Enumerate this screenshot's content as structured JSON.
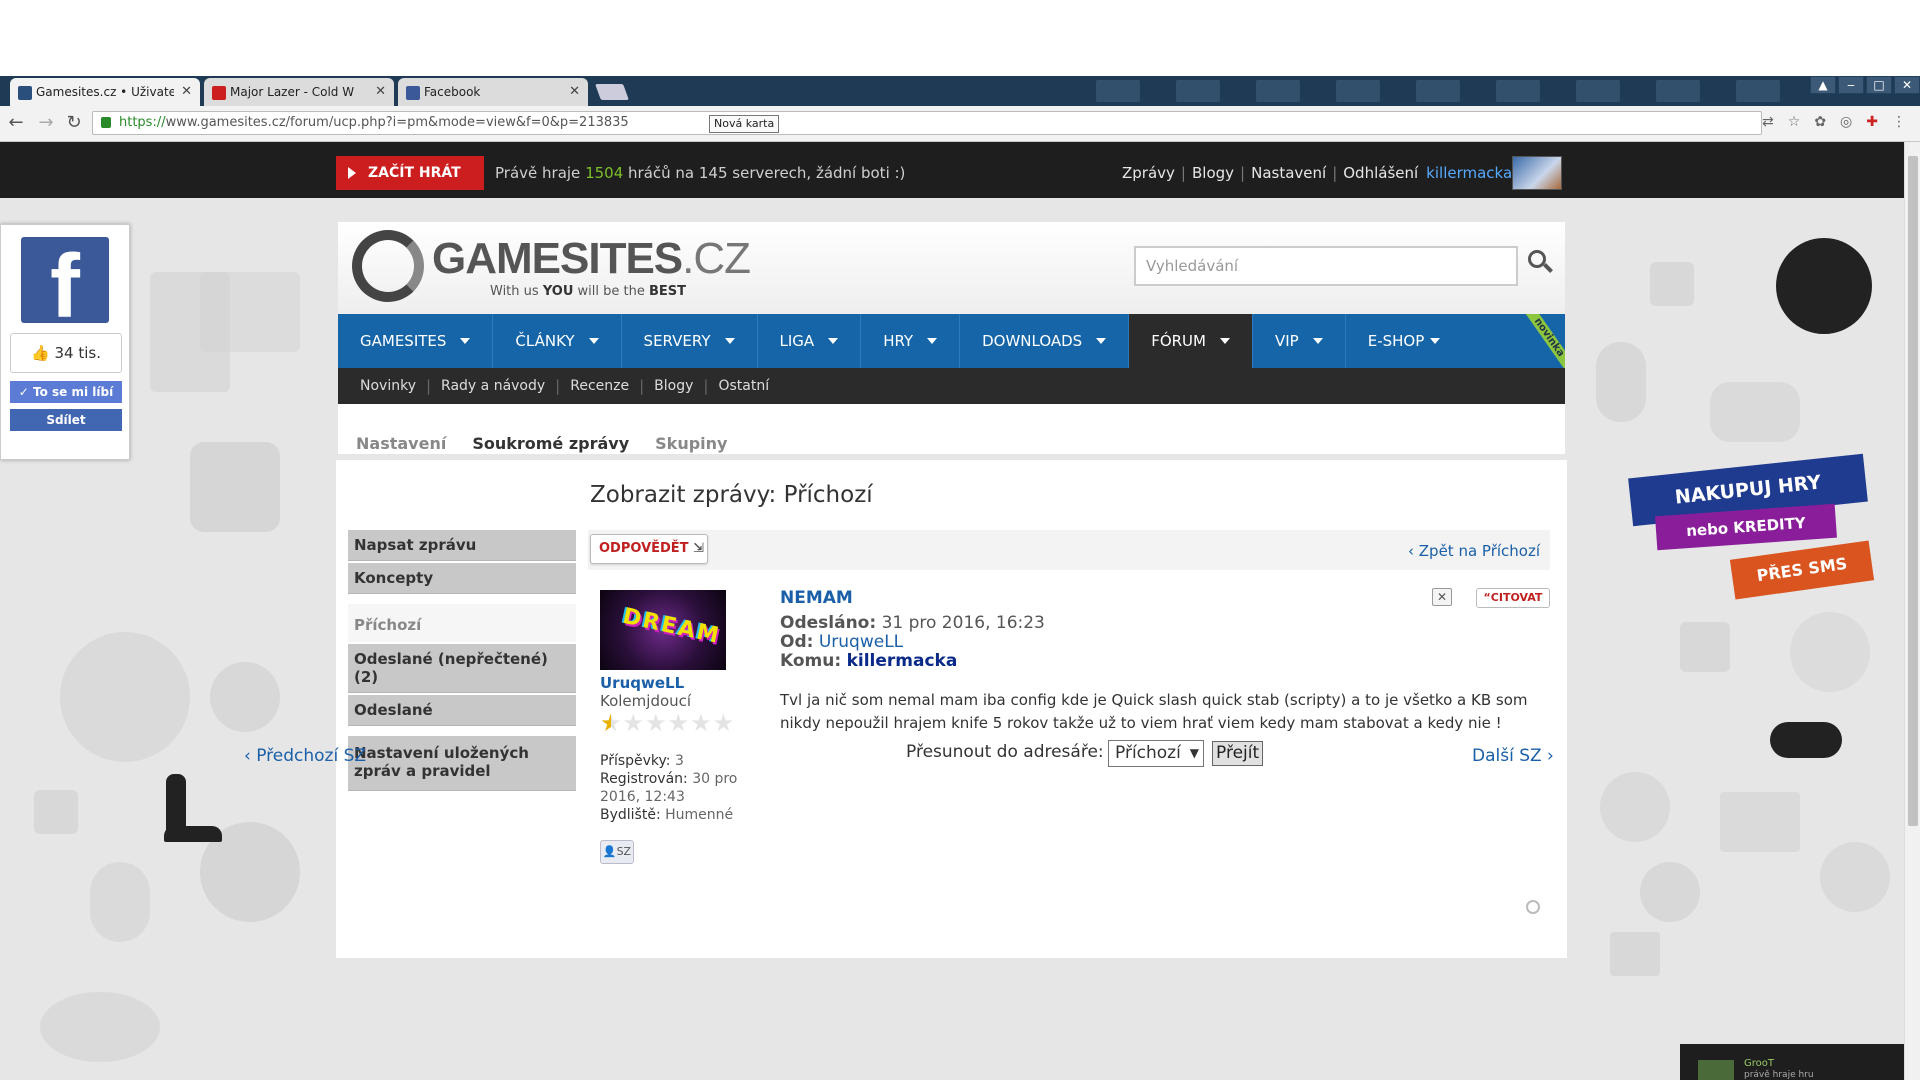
{
  "browser": {
    "tabs": [
      {
        "label": "Gamesites.cz • Uživatelsk",
        "favicon_color": "#2b4f7d"
      },
      {
        "label": "Major Lazer - Cold W",
        "favicon_color": "#cc1e1e"
      },
      {
        "label": "Facebook",
        "favicon_color": "#3b5998"
      }
    ],
    "url_scheme": "https://",
    "url_rest": "www.gamesites.cz/forum/ucp.php?i=pm&mode=view&f=0&p=213835",
    "url_tooltip": "Nová karta"
  },
  "topbar": {
    "play_label": "ZAČÍT HRÁT",
    "players_prefix": "Právě hraje",
    "players_count": "1504",
    "players_suffix": "hráčů na 145 serverech, žádní boti :)",
    "links": [
      "Zprávy",
      "Blogy",
      "Nastavení",
      "Odhlášení"
    ],
    "username": "killermacka"
  },
  "facebook": {
    "likes": "34 tis.",
    "like_label": "To se mi líbí",
    "share_label": "Sdílet"
  },
  "site": {
    "logo_bold": "GAMESITES",
    "logo_thin": ".CZ",
    "slogan_pre": "With us",
    "slogan_you": "YOU",
    "slogan_mid": "will be the",
    "slogan_best": "BEST",
    "search_placeholder": "Vyhledávání"
  },
  "main_nav": [
    "GAMESITES",
    "ČLÁNKY",
    "SERVERY",
    "LIGA",
    "HRY",
    "DOWNLOADS",
    "FÓRUM",
    "VIP",
    "E-SHOP"
  ],
  "ribbon": "novinka",
  "sub_nav": [
    "Novinky",
    "Rady a návody",
    "Recenze",
    "Blogy",
    "Ostatní"
  ],
  "ucp_tabs": [
    "Nastavení",
    "Soukromé zprávy",
    "Skupiny"
  ],
  "page_title": "Zobrazit zprávy: Příchozí",
  "side_menu": {
    "compose": "Napsat zprávu",
    "drafts": "Koncepty",
    "inbox": "Příchozí",
    "outbox": "Odeslané (nepřečtené) (2)",
    "sent": "Odeslané",
    "rules": "Nastavení uložených zpráv a pravidel"
  },
  "toolbar": {
    "reply_label": "ODPOVĚDĚT",
    "back_label": "Zpět na Příchozí"
  },
  "author": {
    "avatar_text": "DREAM",
    "name": "UruqweLL",
    "rank": "Kolemjdoucí",
    "rating": 0.5,
    "posts_label": "Příspěvky:",
    "posts": "3",
    "registered_label": "Registrován:",
    "registered": "30 pro 2016, 12:43",
    "location_label": "Bydliště:",
    "location": "Humenné",
    "pm_label": "SZ"
  },
  "message": {
    "subject": "NEMAM",
    "sent_label": "Odesláno:",
    "sent": "31 pro 2016, 16:23",
    "from_label": "Od:",
    "from": "UruqweLL",
    "to_label": "Komu:",
    "to": "killermacka",
    "body": "Tvl ja nič som nemal mam iba config kde je Quick slash quick stab (scripty) a to je všetko a KB som nikdy nepoužil hrajem knife 5 rokov takže už to viem hrať viem kedy mam stabovat a kedy nie !",
    "quote_label": "CITOVAT"
  },
  "footer_nav": {
    "prev": "Předchozí SZ",
    "move_label": "Přesunout do adresáře:",
    "folder": "Příchozí",
    "go": "Přejít",
    "next": "Další SZ"
  },
  "promo": {
    "line1": "NAKUPUJ HRY",
    "line2": "nebo KREDITY",
    "line3": "PŘES SMS"
  },
  "notification": {
    "name": "GrooT",
    "text": "právě hraje hru"
  }
}
